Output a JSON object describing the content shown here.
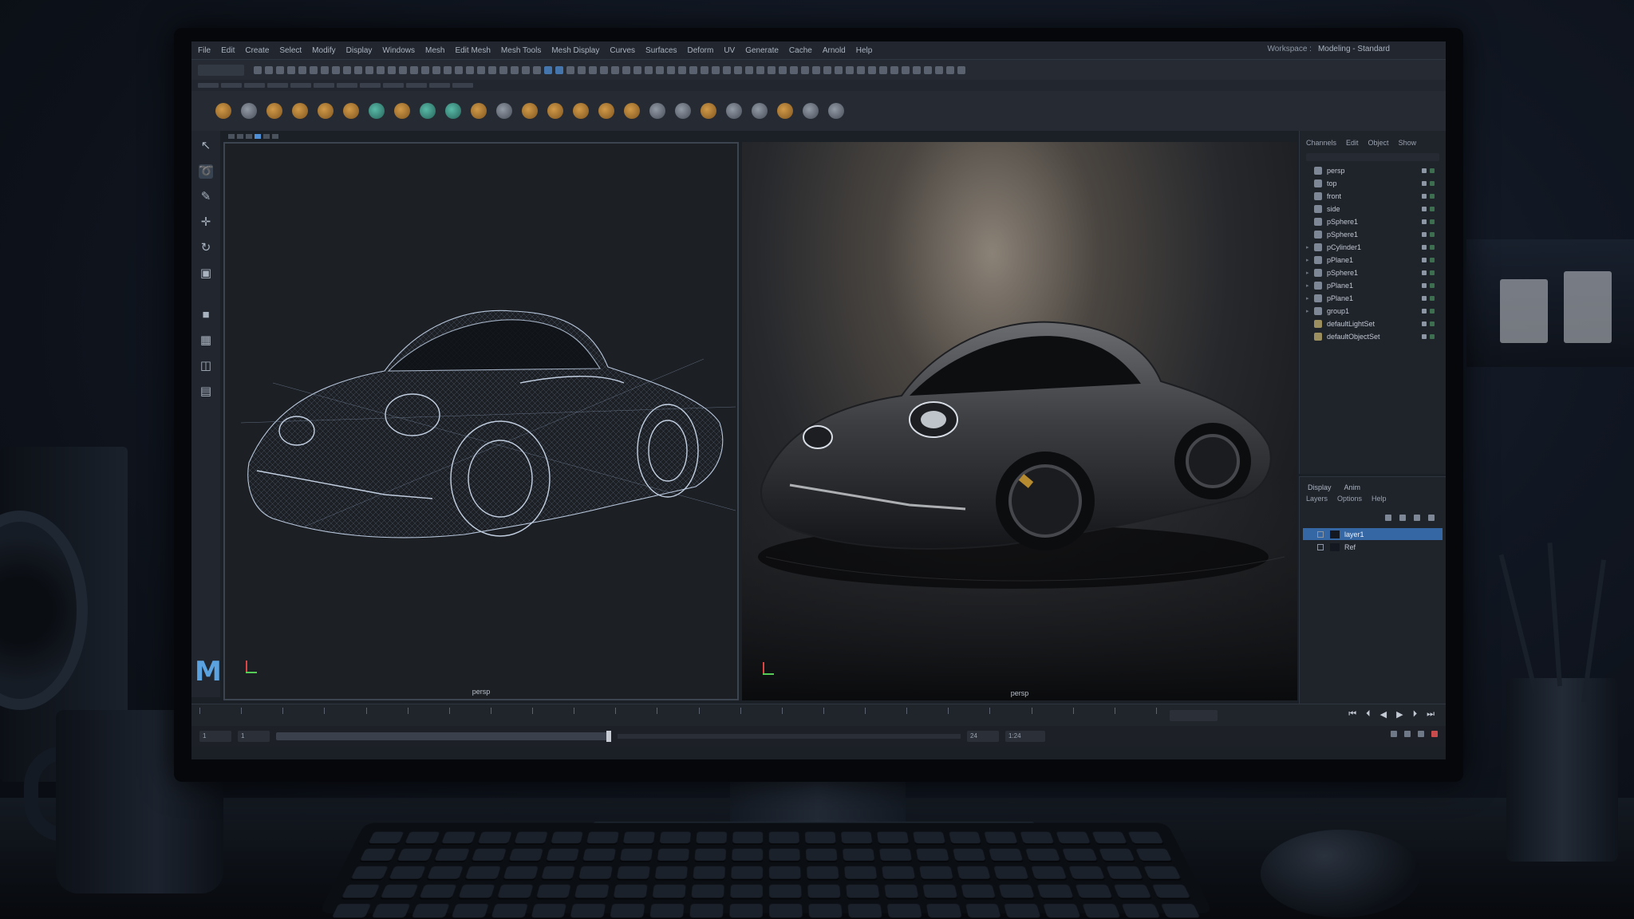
{
  "app": {
    "name": "Maya",
    "logo_letter": "M",
    "workspace_label": "Workspace :",
    "workspace_value": "Modeling - Standard"
  },
  "menubar": [
    "File",
    "Edit",
    "Create",
    "Select",
    "Modify",
    "Display",
    "Windows",
    "Mesh",
    "Edit Mesh",
    "Mesh Tools",
    "Mesh Display",
    "Curves",
    "Surfaces",
    "Deform",
    "UV",
    "Generate",
    "Cache",
    "Arnold",
    "Help"
  ],
  "viewports": {
    "left": {
      "label": "persp",
      "mode": "wireframe"
    },
    "right": {
      "label": "persp",
      "mode": "rendered"
    }
  },
  "outliner": {
    "tabs": [
      "Channels",
      "Edit",
      "Object",
      "Show"
    ],
    "items": [
      {
        "name": "persp",
        "type": "camera",
        "expandable": false
      },
      {
        "name": "top",
        "type": "camera",
        "expandable": false
      },
      {
        "name": "front",
        "type": "camera",
        "expandable": false
      },
      {
        "name": "side",
        "type": "camera",
        "expandable": false
      },
      {
        "name": "pSphere1",
        "type": "mesh",
        "expandable": false
      },
      {
        "name": "pSphere1",
        "type": "mesh",
        "expandable": false
      },
      {
        "name": "pCylinder1",
        "type": "mesh",
        "expandable": true
      },
      {
        "name": "pPlane1",
        "type": "mesh",
        "expandable": true
      },
      {
        "name": "pSphere1",
        "type": "mesh",
        "expandable": true
      },
      {
        "name": "pPlane1",
        "type": "mesh",
        "expandable": true
      },
      {
        "name": "pPlane1",
        "type": "mesh",
        "expandable": true
      },
      {
        "name": "group1",
        "type": "group",
        "expandable": true
      },
      {
        "name": "defaultLightSet",
        "type": "set",
        "expandable": false
      },
      {
        "name": "defaultObjectSet",
        "type": "set",
        "expandable": false
      }
    ]
  },
  "layers_panel": {
    "tabs": [
      "Display",
      "Anim"
    ],
    "menu": [
      "Layers",
      "Options",
      "Help"
    ],
    "layers": [
      {
        "name": "layer1",
        "selected": true
      },
      {
        "name": "Ref",
        "selected": false
      }
    ]
  },
  "timeline": {
    "start_frame": "1",
    "current_frame": "1",
    "range_end": "24",
    "end_frame": "1:24",
    "fps": "24 fps"
  },
  "colors": {
    "accent": "#3567a4",
    "app_bg": "#1b1f26",
    "logo": "#5aa2e0"
  }
}
